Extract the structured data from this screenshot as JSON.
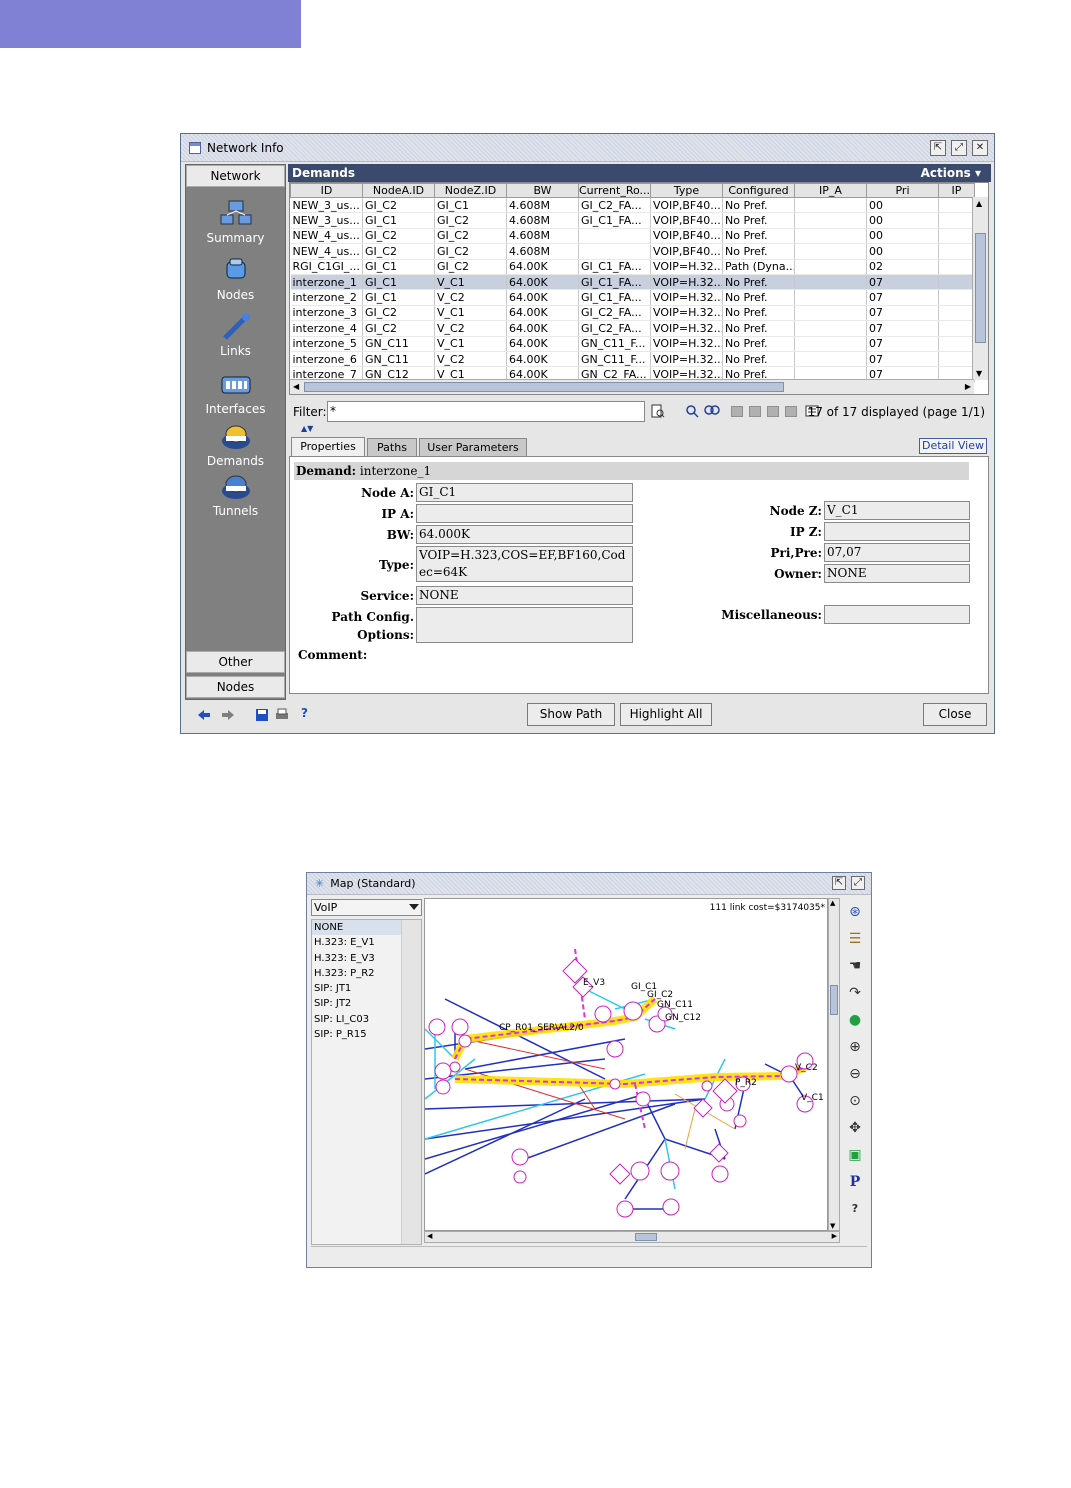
{
  "network_window": {
    "title": "Network Info",
    "sidebar": {
      "header": "Network",
      "items": [
        {
          "label": "Summary",
          "icon": "summary-icon"
        },
        {
          "label": "Nodes",
          "icon": "nodes-icon"
        },
        {
          "label": "Links",
          "icon": "links-icon"
        },
        {
          "label": "Interfaces",
          "icon": "interfaces-icon"
        },
        {
          "label": "Demands",
          "icon": "demands-icon"
        },
        {
          "label": "Tunnels",
          "icon": "tunnels-icon"
        }
      ],
      "footer": [
        "Other",
        "Nodes"
      ]
    },
    "panel_title": "Demands",
    "actions_label": "Actions",
    "table": {
      "columns": [
        "ID",
        "NodeA.ID",
        "NodeZ.ID",
        "BW",
        "Current_Ro...",
        "Type",
        "Configured",
        "IP_A",
        "Pri",
        "IP"
      ],
      "rows": [
        [
          "NEW_3_us...",
          "GI_C2",
          "GI_C1",
          "4.608M",
          "GI_C2_FA...",
          "VOIP,BF40...",
          "No Pref.",
          "",
          "00",
          ""
        ],
        [
          "NEW_3_us...",
          "GI_C1",
          "GI_C2",
          "4.608M",
          "GI_C1_FA...",
          "VOIP,BF40...",
          "No Pref.",
          "",
          "00",
          ""
        ],
        [
          "NEW_4_us...",
          "GI_C2",
          "GI_C2",
          "4.608M",
          "",
          "VOIP,BF40...",
          "No Pref.",
          "",
          "00",
          ""
        ],
        [
          "NEW_4_us...",
          "GI_C2",
          "GI_C2",
          "4.608M",
          "",
          "VOIP,BF40...",
          "No Pref.",
          "",
          "00",
          ""
        ],
        [
          "RGI_C1GI_...",
          "GI_C1",
          "GI_C2",
          "64.00K",
          "GI_C1_FA...",
          "VOIP=H.32...",
          "Path (Dyna...",
          "",
          "02",
          ""
        ],
        [
          "interzone_1",
          "GI_C1",
          "V_C1",
          "64.00K",
          "GI_C1_FA...",
          "VOIP=H.32...",
          "No Pref.",
          "",
          "07",
          ""
        ],
        [
          "interzone_2",
          "GI_C1",
          "V_C2",
          "64.00K",
          "GI_C1_FA...",
          "VOIP=H.32...",
          "No Pref.",
          "",
          "07",
          ""
        ],
        [
          "interzone_3",
          "GI_C2",
          "V_C1",
          "64.00K",
          "GI_C2_FA...",
          "VOIP=H.32...",
          "No Pref.",
          "",
          "07",
          ""
        ],
        [
          "interzone_4",
          "GI_C2",
          "V_C2",
          "64.00K",
          "GI_C2_FA...",
          "VOIP=H.32...",
          "No Pref.",
          "",
          "07",
          ""
        ],
        [
          "interzone_5",
          "GN_C11",
          "V_C1",
          "64.00K",
          "GN_C11_F...",
          "VOIP=H.32...",
          "No Pref.",
          "",
          "07",
          ""
        ],
        [
          "interzone_6",
          "GN_C11",
          "V_C2",
          "64.00K",
          "GN_C11_F...",
          "VOIP=H.32...",
          "No Pref.",
          "",
          "07",
          ""
        ],
        [
          "interzone_7",
          "GN_C12",
          "V_C1",
          "64.00K",
          "GN_C2_FA...",
          "VOIP=H.32...",
          "No Pref.",
          "",
          "07",
          ""
        ]
      ],
      "selected_row": 5
    },
    "filter": {
      "label": "Filter:",
      "value": "*",
      "display_count": "17 of 17 displayed (page 1/1)"
    },
    "tabs": [
      "Properties",
      "Paths",
      "User Parameters"
    ],
    "detail_view": "Detail View",
    "properties": {
      "demand_label": "Demand:",
      "demand_value": "interzone_1",
      "node_a_label": "Node A:",
      "node_a": "GI_C1",
      "ip_a_label": "IP A:",
      "ip_a": "",
      "bw_label": "BW:",
      "bw": "64.000K",
      "type_label": "Type:",
      "type": "VOIP=H.323,COS=EF,BF160,Codec=64K",
      "service_label": "Service:",
      "service": "NONE",
      "path_config_label": "Path Config. Options:",
      "path_config": "",
      "comment_label": "Comment:",
      "node_z_label": "Node Z:",
      "node_z": "V_C1",
      "ip_z_label": "IP Z:",
      "ip_z": "",
      "pri_pre_label": "Pri,Pre:",
      "pri_pre": "07,07",
      "owner_label": "Owner:",
      "owner": "NONE",
      "misc_label": "Miscellaneous:",
      "misc": ""
    },
    "buttons": {
      "show_path": "Show Path",
      "highlight_all": "Highlight All",
      "close": "Close"
    }
  },
  "map_window": {
    "title": "Map (Standard)",
    "combo_value": "VoIP",
    "list": [
      "NONE",
      "H.323: E_V1",
      "H.323: E_V3",
      "H.323: P_R2",
      "SIP: JT1",
      "SIP: JT2",
      "SIP: LI_C03",
      "SIP: P_R15"
    ],
    "cost_text": "111 link cost=$3174035*",
    "node_labels": {
      "e_v3": "E_V3",
      "gi_c1": "GI_C1",
      "gi_c2": "GI_C2",
      "gn_c11": "GN_C11",
      "gn_c12": "GN_C12",
      "link": "CP_R01_SER\\AL2/0",
      "p_r2": "P_R2",
      "v_c2": "V_C2",
      "v_c1": "V_C1"
    }
  }
}
